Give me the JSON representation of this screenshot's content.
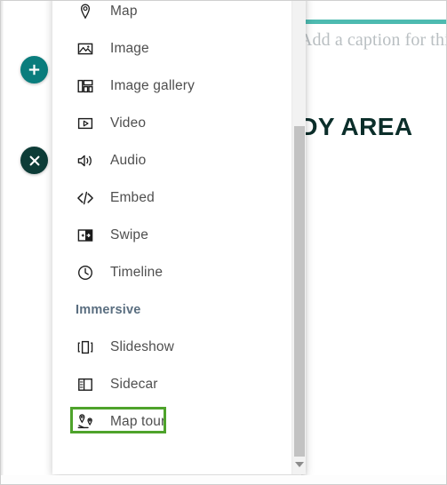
{
  "canvas": {
    "caption_placeholder": "Add a caption for this",
    "headline": "STUDY AREA",
    "accent_color": "#4dbab0",
    "headline_color": "#0b2e2a",
    "caption_color": "#b9bfc2"
  },
  "rail": {
    "add_button": {
      "icon": "plus-icon",
      "label": "Add block",
      "color": "#0a7d7d"
    },
    "close_button": {
      "icon": "close-icon",
      "label": "Close",
      "color": "#0d3c37"
    }
  },
  "panel": {
    "highlight_color": "#4ea32b",
    "highlighted_item": "Map tour",
    "items": [
      {
        "label": "Map",
        "icon": "map-pin-icon",
        "section": "basic"
      },
      {
        "label": "Image",
        "icon": "image-icon",
        "section": "basic"
      },
      {
        "label": "Image gallery",
        "icon": "image-gallery-icon",
        "section": "basic"
      },
      {
        "label": "Video",
        "icon": "video-icon",
        "section": "basic"
      },
      {
        "label": "Audio",
        "icon": "audio-icon",
        "section": "basic"
      },
      {
        "label": "Embed",
        "icon": "embed-code-icon",
        "section": "basic"
      },
      {
        "label": "Swipe",
        "icon": "swipe-icon",
        "section": "basic"
      },
      {
        "label": "Timeline",
        "icon": "clock-icon",
        "section": "basic"
      }
    ],
    "section_header": "Immersive",
    "immersive_items": [
      {
        "label": "Slideshow",
        "icon": "slideshow-icon"
      },
      {
        "label": "Sidecar",
        "icon": "sidecar-icon"
      },
      {
        "label": "Map tour",
        "icon": "map-tour-icon"
      }
    ]
  },
  "scrollbar": {
    "down_arrow_icon": "chevron-down-icon"
  }
}
